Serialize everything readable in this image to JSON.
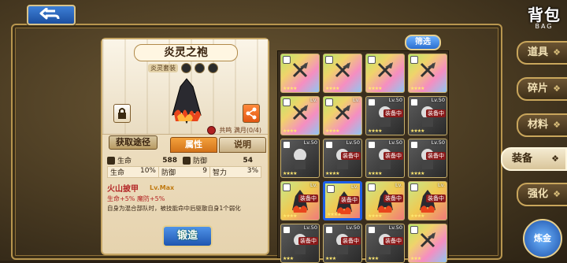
{
  "header": {
    "title_cn": "背包",
    "title_en": "BAG"
  },
  "detail": {
    "item_name": "炎灵之袍",
    "series_tag": "炎灵套装",
    "resonance": "共鸣 满月(0/4)",
    "acquire_label": "获取途径",
    "tabs": [
      "属性",
      "说明"
    ],
    "stats": {
      "hp_label": "生命",
      "hp_value": "588",
      "def_label": "防御",
      "def_value": "54",
      "hp_pct_label": "生命",
      "hp_pct_value": "10%",
      "def2_label": "防御",
      "def2_value": "9",
      "int_label": "智力",
      "int_value": "3%"
    },
    "skill": {
      "name": "火山披甲",
      "level": "Lv.Max",
      "bonus": "生命+5%  魔防+5%",
      "desc": "自身为混合部队时，被技能命中后驱散自身1个弱化"
    },
    "forge_label": "锻造"
  },
  "grid": {
    "filter_label": "筛选",
    "items": [
      {
        "type": "rainbow",
        "lv": "",
        "equip": "",
        "stars": "★★★★"
      },
      {
        "type": "rainbow",
        "lv": "",
        "equip": "",
        "stars": "★★★★"
      },
      {
        "type": "rainbow",
        "lv": "",
        "equip": "",
        "stars": "★★★★"
      },
      {
        "type": "rainbow",
        "lv": "",
        "equip": "",
        "stars": "★★★★"
      },
      {
        "type": "rainbow",
        "lv": "Lv.",
        "equip": "",
        "stars": "★★★★"
      },
      {
        "type": "rainbow",
        "lv": "Lv.",
        "equip": "",
        "stars": "★★★★"
      },
      {
        "type": "dark",
        "lv": "Lv.50",
        "equip": "装备中",
        "stars": "★★★★"
      },
      {
        "type": "dark",
        "lv": "Lv.50",
        "equip": "装备中",
        "stars": "★★★★"
      },
      {
        "type": "dark",
        "lv": "Lv.50",
        "equip": "",
        "stars": "★★★★"
      },
      {
        "type": "dark",
        "lv": "Lv.50",
        "equip": "装备中",
        "stars": "★★★★"
      },
      {
        "type": "dark",
        "lv": "Lv.50",
        "equip": "装备中",
        "stars": "★★★★"
      },
      {
        "type": "dark",
        "lv": "Lv.50",
        "equip": "装备中",
        "stars": "★★★★"
      },
      {
        "type": "fire",
        "lv": "Lv.",
        "equip": "装备中",
        "stars": "★★★★"
      },
      {
        "type": "fire",
        "lv": "Lv.",
        "equip": "装备中",
        "stars": "★★★★"
      },
      {
        "type": "fire",
        "lv": "Lv.",
        "equip": "装备中",
        "stars": "★★★★"
      },
      {
        "type": "fire",
        "lv": "Lv.",
        "equip": "装备中",
        "stars": "★★★★"
      },
      {
        "type": "dark",
        "lv": "Lv.50",
        "equip": "装备中",
        "stars": "★★★"
      },
      {
        "type": "dark",
        "lv": "Lv.50",
        "equip": "装备中",
        "stars": "★★★"
      },
      {
        "type": "dark",
        "lv": "Lv.50",
        "equip": "装备中",
        "stars": "★★★"
      },
      {
        "type": "rainbow",
        "lv": "",
        "equip": "",
        "stars": "★★★"
      }
    ]
  },
  "side_menu": {
    "items": [
      "道具",
      "碎片",
      "材料",
      "装备",
      "强化"
    ],
    "active_index": 3,
    "merge_label": "炼金"
  },
  "colors": {
    "accent_blue": "#1d5ee8",
    "frame_gold": "#c9a65c"
  }
}
